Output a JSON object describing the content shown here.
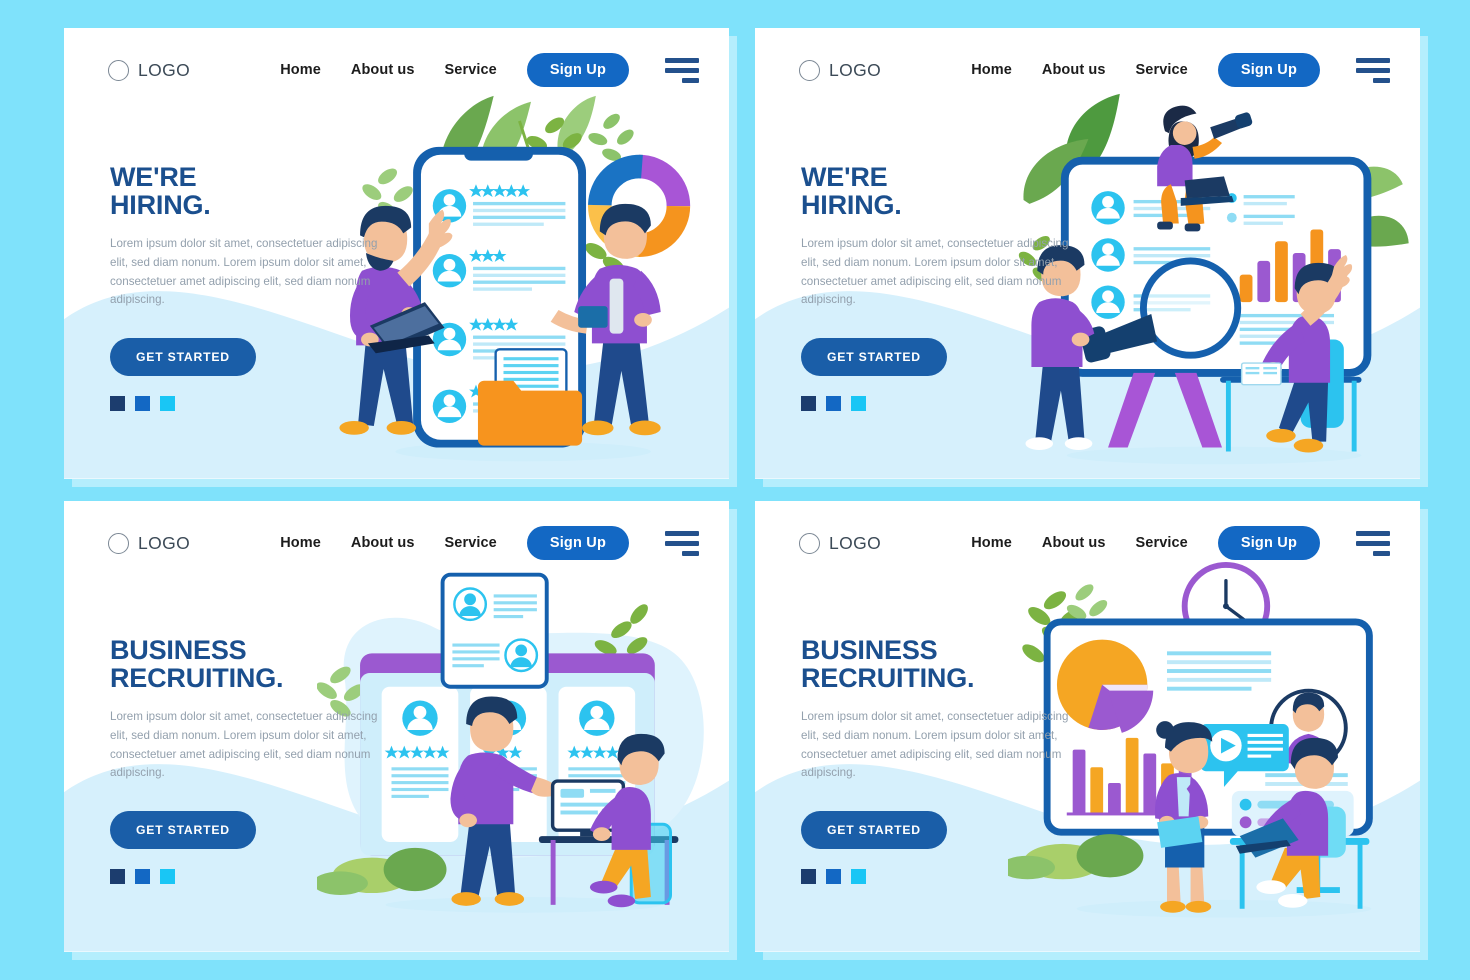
{
  "background_color": "#7fe2fb",
  "theme": {
    "primary_blue": "#1368c4",
    "deep_blue": "#1b4f8e",
    "cta_blue": "#1a5ea8",
    "navy": "#1c3d6e",
    "cyan": "#19c6f5",
    "orange": "#f5a623",
    "purple": "#9b59d0",
    "green": "#7cb342",
    "body_text": "#93a0ad",
    "nav_text": "#1c1c1c",
    "panel_bg": "#ffffff",
    "wave_fill": "#d6f0fc"
  },
  "nav": {
    "logo_icon": "circle-outline-icon",
    "logo_label": "LOGO",
    "links": [
      {
        "label": "Home",
        "name": "nav-link-home"
      },
      {
        "label": "About us",
        "name": "nav-link-about-us"
      },
      {
        "label": "Service",
        "name": "nav-link-service"
      }
    ],
    "signup_label": "Sign Up",
    "menu_icon": "hamburger-menu-icon"
  },
  "common": {
    "body_text": "Lorem ipsum dolor sit amet, consectetuer adipiscing elit, sed diam nonum. Lorem ipsum dolor sit amet, consectetuer amet adipiscing elit, sed diam nonum adipiscing.",
    "cta_label": "GET STARTED",
    "pagination_dots": [
      "#1c3d6e",
      "#1368c4",
      "#19c6f5"
    ]
  },
  "panels": [
    {
      "id": "panel-hiring-mobile",
      "headline": "WE'RE\nHIRING.",
      "illustration": "mobile-candidate-list",
      "illustration_elements": [
        "smartphone-mockup",
        "candidate-row-avatar",
        "star-rating",
        "donut-chart",
        "orange-folder",
        "man-with-laptop",
        "man-with-tablet",
        "leaf-plants"
      ],
      "star_ratings": [
        5,
        3,
        4,
        2
      ],
      "donut_segments": [
        {
          "color": "#a855d6",
          "label": "purple"
        },
        {
          "color": "#f5941e",
          "label": "orange"
        },
        {
          "color": "#fbc04a",
          "label": "light-orange"
        },
        {
          "color": "#1a73c4",
          "label": "blue"
        }
      ]
    },
    {
      "id": "panel-hiring-board",
      "headline": "WE'RE\nHIRING.",
      "illustration": "presentation-board-search",
      "illustration_elements": [
        "whiteboard-easel",
        "candidate-row-avatar",
        "bar-chart",
        "magnifying-glass",
        "woman-with-telescope-and-laptop",
        "man-holding-magnifier",
        "man-at-desk-reading",
        "leaf-plants"
      ],
      "bar_chart_values": [
        22,
        38,
        62,
        48,
        78,
        54
      ],
      "bar_chart_colors": [
        "#f5941e",
        "#9b59d0",
        "#f5941e",
        "#9b59d0",
        "#f5941e",
        "#9b59d0"
      ]
    },
    {
      "id": "panel-recruiting-cards",
      "headline": "BUSINESS\nRECRUITING.",
      "illustration": "candidate-cards-board",
      "illustration_elements": [
        "candidate-card",
        "floating-resume-card",
        "star-rating",
        "man-pointing",
        "man-at-computer-desk",
        "bushes",
        "leaf-plants"
      ],
      "star_ratings": [
        5,
        3,
        4
      ]
    },
    {
      "id": "panel-recruiting-dashboard",
      "headline": "BUSINESS\nRECRUITING.",
      "illustration": "analytics-dashboard-board",
      "illustration_elements": [
        "dashboard-board",
        "pie-chart",
        "bar-chart",
        "wall-clock",
        "profile-avatar-circle",
        "video-message-bubble",
        "toggle-sliders",
        "woman-with-folder",
        "man-at-laptop-desk",
        "bushes",
        "leaf-plants"
      ],
      "bar_chart_values": [
        58,
        38,
        26,
        74,
        54,
        44,
        66
      ],
      "bar_chart_colors": [
        "#9b59d0",
        "#f5a623",
        "#9b59d0",
        "#f5a623",
        "#9b59d0",
        "#f5a623",
        "#9b59d0"
      ],
      "pie_segments": [
        {
          "color": "#f5a623",
          "label": "orange",
          "share": 72
        },
        {
          "color": "#9b59d0",
          "label": "purple",
          "share": 28
        }
      ]
    }
  ]
}
